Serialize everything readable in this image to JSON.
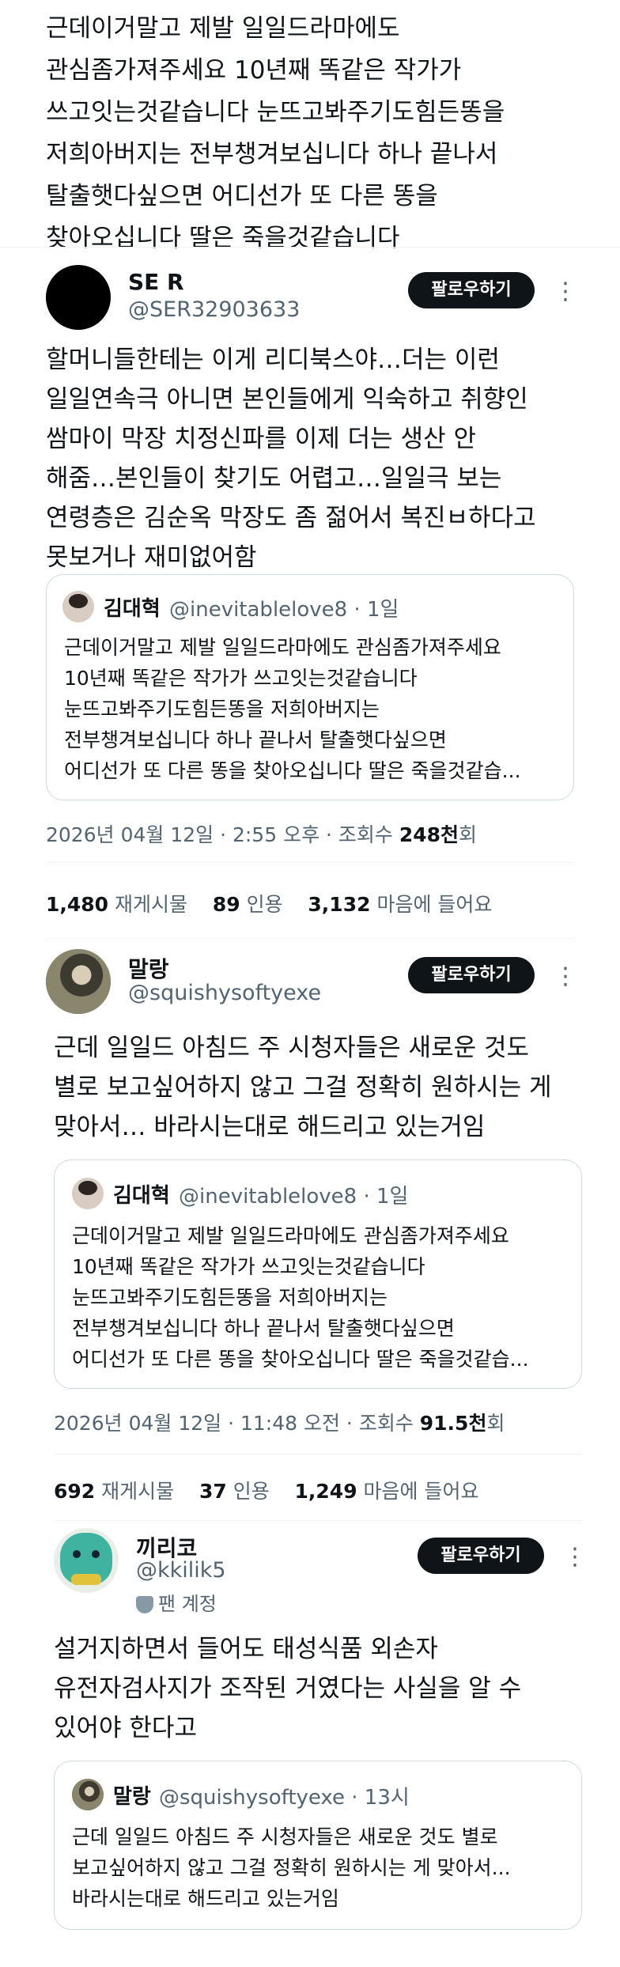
{
  "top_tweet": {
    "text": "근데이거말고 제발 일일드라마에도\n관심좀가져주세요 10년째 똑같은 작가가\n쓰고잇는것같습니다 눈뜨고봐주기도힘든똥을\n저희아버지는 전부챙겨보십니다 하나 끝나서\n탈출햇다싶으면 어디선가 또 다른 똥을\n찾아오십니다 딸은 죽을것같습니다"
  },
  "follow_label": "팔로우하기",
  "more_glyph": "⋮",
  "tweets": [
    {
      "name": "SE R",
      "handle": "@SER32903633",
      "avatar_color": "#000000",
      "text": "할머니들한테는 이게 리디북스야…더는 이런\n일일연속극 아니면 본인들에게 익숙하고 취향인\n쌈마이 막장 치정신파를 이제 더는 생산 안\n해줌…본인들이 찾기도 어렵고…일일극 보는\n연령층은 김순옥 막장도 좀 젊어서 복진ㅂ하다고\n못보거나 재미없어함",
      "quote": {
        "name": "김대혁",
        "handle_time": "@inevitablelove8 · 1일",
        "text": "근데이거말고 제발 일일드라마에도 관심좀가져주세요\n10년째 똑같은 작가가 쓰고잇는것같습니다\n눈뜨고봐주기도힘든똥을 저희아버지는\n전부챙겨보십니다 하나 끝나서 탈출햇다싶으면\n어디선가 또 다른 똥을 찾아오십니다 딸은 죽을것같습..."
      },
      "meta_prefix": "2026년 04월 12일 · 2:55 오후 · 조회수 ",
      "views": "248천",
      "views_suffix": "회",
      "retweets": "1,480",
      "retweets_label": "재게시물",
      "quotes": "89",
      "quotes_label": "인용",
      "likes": "3,132",
      "likes_label": "마음에 들어요"
    },
    {
      "name": "말랑",
      "handle": "@squishysoftyexe",
      "avatar_color": "#5a5a4c",
      "text": "근데 일일드 아침드 주 시청자들은 새로운 것도\n별로 보고싶어하지 않고 그걸 정확히 원하시는 게\n맞아서… 바라시는대로 해드리고 있는거임",
      "quote": {
        "name": "김대혁",
        "handle_time": "@inevitablelove8 · 1일",
        "text": "근데이거말고 제발 일일드라마에도 관심좀가져주세요\n10년째 똑같은 작가가 쓰고잇는것같습니다\n눈뜨고봐주기도힘든똥을 저희아버지는\n전부챙겨보십니다 하나 끝나서 탈출햇다싶으면\n어디선가 또 다른 똥을 찾아오십니다 딸은 죽을것같습..."
      },
      "meta_prefix": "2026년 04월 12일 · 11:48 오전 · 조회수 ",
      "views": "91.5천",
      "views_suffix": "회",
      "retweets": "692",
      "retweets_label": "재게시물",
      "quotes": "37",
      "quotes_label": "인용",
      "likes": "1,249",
      "likes_label": "마음에 들어요"
    },
    {
      "name": "끼리코",
      "handle": "@kkilik5",
      "badge": "팬 계정",
      "avatar_color": "#3fb3a0",
      "text": "설거지하면서 들어도 태성식품 외손자\n유전자검사지가 조작된 거였다는 사실을 알 수\n있어야 한다고",
      "quote": {
        "name": "말랑",
        "handle_time": "@squishysoftyexe · 13시",
        "text": "근데 일일드 아침드 주 시청자들은 새로운 것도 별로\n보고싶어하지 않고 그걸 정확히 원하시는 게 맞아서...\n바라시는대로 해드리고 있는거임"
      }
    }
  ]
}
